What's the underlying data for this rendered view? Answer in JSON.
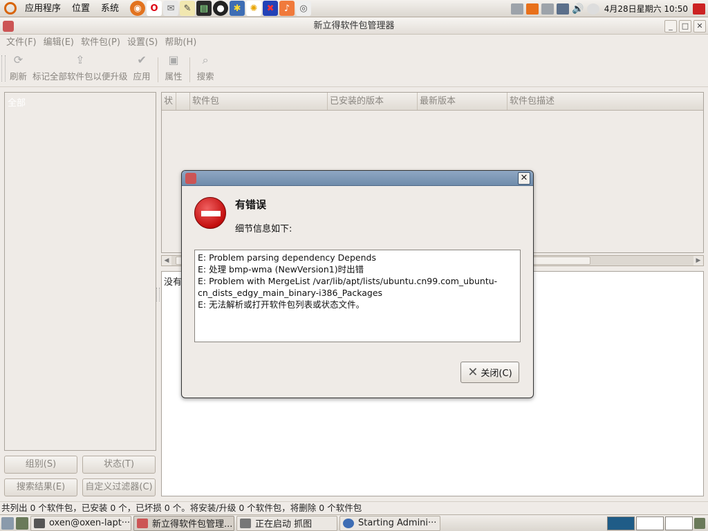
{
  "top_panel": {
    "menus": [
      "应用程序",
      "位置",
      "系统"
    ],
    "launchers": [
      "firefox-icon",
      "opera-icon",
      "mail-icon",
      "editor-icon",
      "terminal-icon",
      "qq-icon",
      "settings-icon",
      "lamp-icon",
      "game-icon",
      "music-icon",
      "screenshot-icon"
    ],
    "clock": "4月28日星期六 10:50"
  },
  "window": {
    "title": "新立得软件包管理器",
    "menubar": [
      "文件(F)",
      "编辑(E)",
      "软件包(P)",
      "设置(S)",
      "帮助(H)"
    ],
    "toolbar": [
      {
        "label": "刷新",
        "icon": "refresh-icon"
      },
      {
        "label": "标记全部软件包以便升级",
        "icon": "upgrade-icon"
      },
      {
        "label": "应用",
        "icon": "apply-icon"
      },
      {
        "label": "属性",
        "icon": "properties-icon"
      },
      {
        "label": "搜索",
        "icon": "search-icon"
      }
    ]
  },
  "left_panel": {
    "selected_filter": "全部",
    "buttons": [
      "组别(S)",
      "状态(T)",
      "搜索结果(E)",
      "自定义过滤器(C)"
    ]
  },
  "package_list": {
    "columns": [
      "状",
      "",
      "软件包",
      "已安装的版本",
      "最新版本",
      "软件包描述"
    ]
  },
  "description": {
    "text": "没有"
  },
  "statusbar": {
    "text": "共列出 0 个软件包，已安装 0 个，已坏损 0 个。将安装/升级 0 个软件包，将删除 0 个软件包"
  },
  "taskbar": {
    "tasks": [
      {
        "label": "oxen@oxen-lapt···",
        "active": false
      },
      {
        "label": "新立得软件包管理...",
        "active": true
      },
      {
        "label": "正在启动 抓图",
        "active": false
      },
      {
        "label": "Starting Admini···",
        "active": false
      }
    ]
  },
  "dialog": {
    "heading": "有错误",
    "subheading": "细节信息如下:",
    "details": [
      "E: Problem parsing dependency Depends",
      "E: 处理 bmp-wma (NewVersion1)时出错",
      "E: Problem with MergeList /var/lib/apt/lists/ubuntu.cn99.com_ubuntu-",
      "cn_dists_edgy_main_binary-i386_Packages",
      "E: 无法解析或打开软件包列表或状态文件。"
    ],
    "close_button": "关闭(C)",
    "close_icon": "close-icon"
  },
  "colors": {
    "dialog_titlebar": "#7b96b5",
    "error_red": "#c30e0e",
    "selected_filter_bg": "#1f5c87"
  }
}
